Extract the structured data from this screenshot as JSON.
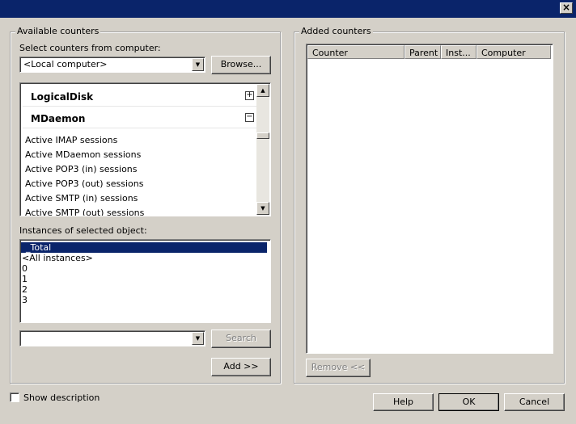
{
  "titlebar": {
    "close_glyph": "×",
    "close_icon": "close-icon"
  },
  "available_group": {
    "label": "Available counters",
    "computer_label": "Select counters from computer:",
    "computer_value": "<Local computer>",
    "browse_label": "Browse...",
    "objects": [
      {
        "name": "LogicalDisk",
        "toggle": "+",
        "expanded": false
      },
      {
        "name": "MDaemon",
        "toggle": "−",
        "expanded": true
      }
    ],
    "counters": [
      "Active IMAP sessions",
      "Active MDaemon sessions",
      "Active POP3 (in) sessions",
      "Active POP3 (out) sessions",
      "Active SMTP (in) sessions",
      "Active SMTP (out) sessions"
    ],
    "instances_label": "Instances of selected object:",
    "instances": [
      "_Total",
      "<All instances>",
      "0",
      "1",
      "2",
      "3"
    ],
    "selected_instance": "_Total",
    "search_value": "",
    "search_label": "Search",
    "add_label": "Add >>"
  },
  "added_group": {
    "label": "Added counters",
    "columns": [
      "Counter",
      "Parent",
      "Inst...",
      "Computer"
    ],
    "rows": [],
    "remove_label": "Remove <<"
  },
  "footer": {
    "show_description_label": "Show description",
    "show_description_checked": false,
    "help_label": "Help",
    "ok_label": "OK",
    "cancel_label": "Cancel"
  },
  "colors": {
    "titlebar": "#0a246a",
    "dialog_bg": "#d4d0c8",
    "selection": "#0a246a"
  }
}
